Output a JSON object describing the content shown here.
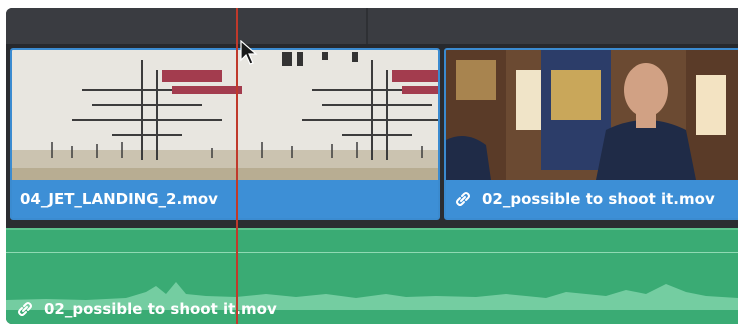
{
  "clips": {
    "video": [
      {
        "name": "04_JET_LANDING_2.mov",
        "linked": false
      },
      {
        "name": "02_possible to shoot it.mov",
        "linked": true
      }
    ],
    "audio": {
      "name": "02_possible to shoot it.mov",
      "linked": true
    }
  },
  "icons": {
    "link": "link-icon",
    "cursor": "mouse-pointer-icon"
  },
  "colors": {
    "video_clip": "#3d8fd6",
    "audio_clip": "#3aab74",
    "playhead": "#c0392b",
    "panel_bg": "#2b2d31"
  }
}
